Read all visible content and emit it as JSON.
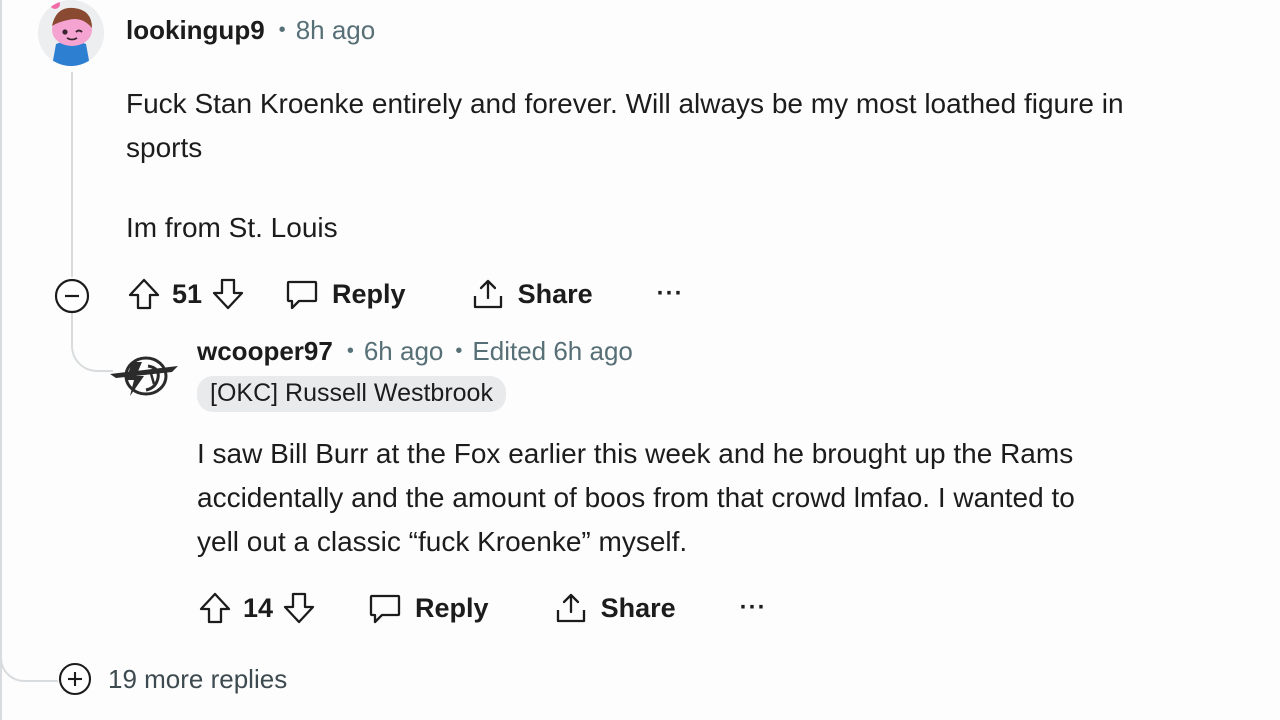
{
  "comment": {
    "username": "lookingup9",
    "time": "8h ago",
    "body_line1": "Fuck Stan Kroenke entirely and forever. Will always be my most loathed figure in",
    "body_line2": "sports",
    "body_line3": "Im from St. Louis",
    "votes": "51",
    "reply_label": "Reply",
    "share_label": "Share",
    "more_label": "···"
  },
  "reply": {
    "username": "wcooper97",
    "time": "6h ago",
    "edited": "Edited 6h ago",
    "flair": "[OKC] Russell Westbrook",
    "body_line1": "I saw Bill Burr at the Fox earlier this week and he brought up the Rams",
    "body_line2": "accidentally and the amount of boos from that crowd lmfao. I wanted to",
    "body_line3": "yell out a classic “fuck Kroenke” myself.",
    "votes": "14",
    "reply_label": "Reply",
    "share_label": "Share",
    "more_label": "···"
  },
  "more_replies_label": "19 more replies",
  "icons": {
    "upvote": "arrow-up-icon",
    "downvote": "arrow-down-icon",
    "reply": "speech-bubble-icon",
    "share": "share-icon",
    "collapse": "minus-circle-icon",
    "expand": "plus-circle-icon"
  },
  "colors": {
    "text": "#1c1c1c",
    "meta": "#576f76",
    "thread_line": "#d9dcde",
    "flair_bg": "#e8eaec"
  }
}
